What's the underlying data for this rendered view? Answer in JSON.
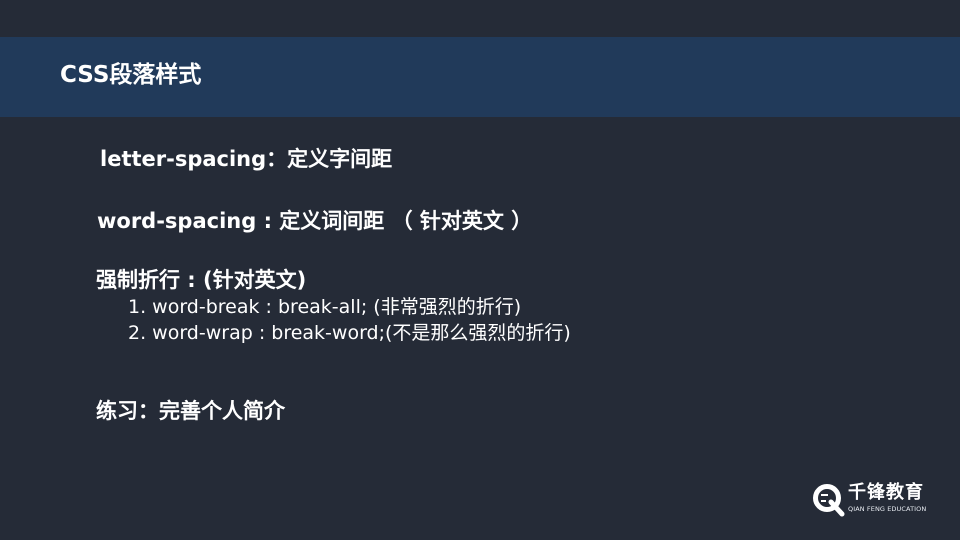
{
  "slide": {
    "title": "CSS段落样式",
    "lines": {
      "letter_spacing": "letter-spacing：定义字间距",
      "word_spacing": "word-spacing : 定义词间距 （ 针对英文 ）",
      "force_wrap_heading": "强制折行 : (针对英文)",
      "word_break": "1. word-break : break-all; (非常强烈的折行)",
      "word_wrap": "2. word-wrap : break-word;(不是那么强烈的折行)",
      "exercise": "练习：完善个人简介"
    }
  },
  "logo": {
    "name": "千锋教育",
    "subtitle": "QIAN FENG EDUCATION",
    "icon": "qianfeng-logo-icon"
  },
  "colors": {
    "background": "#252b37",
    "title_bar": "#213a5a",
    "text": "#ffffff"
  }
}
